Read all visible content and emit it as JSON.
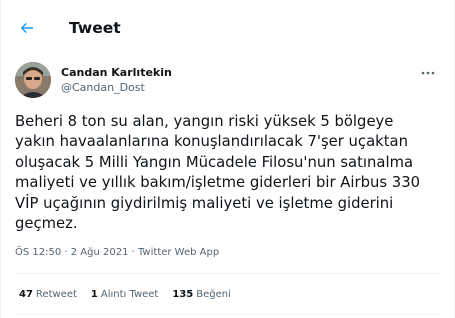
{
  "header": {
    "title": "Tweet",
    "back_icon": "arrow-left-icon",
    "accent_color": "#1d9bf0"
  },
  "author": {
    "display_name": "Candan Karlıtekin",
    "handle": "@Candan_Dost",
    "more_icon": "more-horizontal-icon"
  },
  "tweet": {
    "text": "Beheri 8 ton su alan, yangın riski yüksek 5 bölgeye\nyakın havaalanlarına konuşlandırılacak 7'şer uçaktan\noluşacak 5 Milli Yangın Mücadele Filosu'nun satınalma\nmaliyeti ve yıllık bakım/işletme giderleri bir Airbus 330\nVİP uçağının giydirilmiş maliyeti ve işletme giderini\ngeçmez.",
    "meta": "ÖS 12:50 · 2 Ağu 2021 · Twitter Web App"
  },
  "stats": {
    "retweets": {
      "count": "47",
      "label": "Retweet"
    },
    "quotes": {
      "count": "1",
      "label": "Alıntı Tweet"
    },
    "likes": {
      "count": "135",
      "label": "Beğeni"
    }
  }
}
